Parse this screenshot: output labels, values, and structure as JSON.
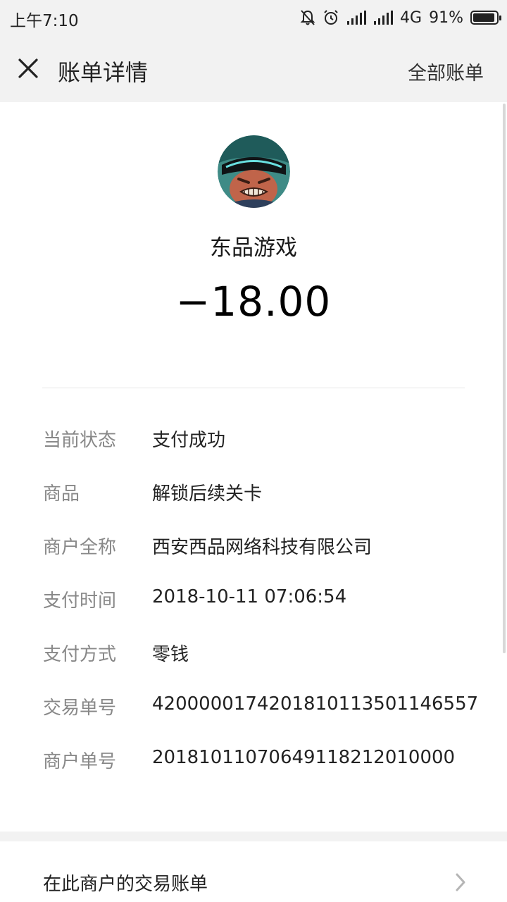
{
  "status_bar": {
    "time": "上午7:10",
    "network": "4G",
    "battery": "91%",
    "icons": [
      "mute-bell-icon",
      "alarm-icon",
      "signal-icon",
      "signal-icon",
      "battery-icon"
    ]
  },
  "nav": {
    "title": "账单详情",
    "right_link": "全部账单",
    "close_icon": "close-icon"
  },
  "header": {
    "merchant": "东品游戏",
    "amount": "−18.00"
  },
  "details": [
    {
      "label": "当前状态",
      "value": "支付成功"
    },
    {
      "label": "商品",
      "value": "解锁后续关卡"
    },
    {
      "label": "商户全称",
      "value": "西安西品网络科技有限公司"
    },
    {
      "label": "支付时间",
      "value": "2018-10-11 07:06:54"
    },
    {
      "label": "支付方式",
      "value": "零钱"
    },
    {
      "label": "交易单号",
      "value": "4200000174201810113501146557"
    },
    {
      "label": "商户单号",
      "value": "20181011070649118212010000"
    }
  ],
  "footer_link": {
    "label": "在此商户的交易账单",
    "icon": "chevron-right-icon"
  },
  "colors": {
    "bar_bg": "#f2f2f2",
    "label_gray": "#888888",
    "text": "#222222"
  }
}
